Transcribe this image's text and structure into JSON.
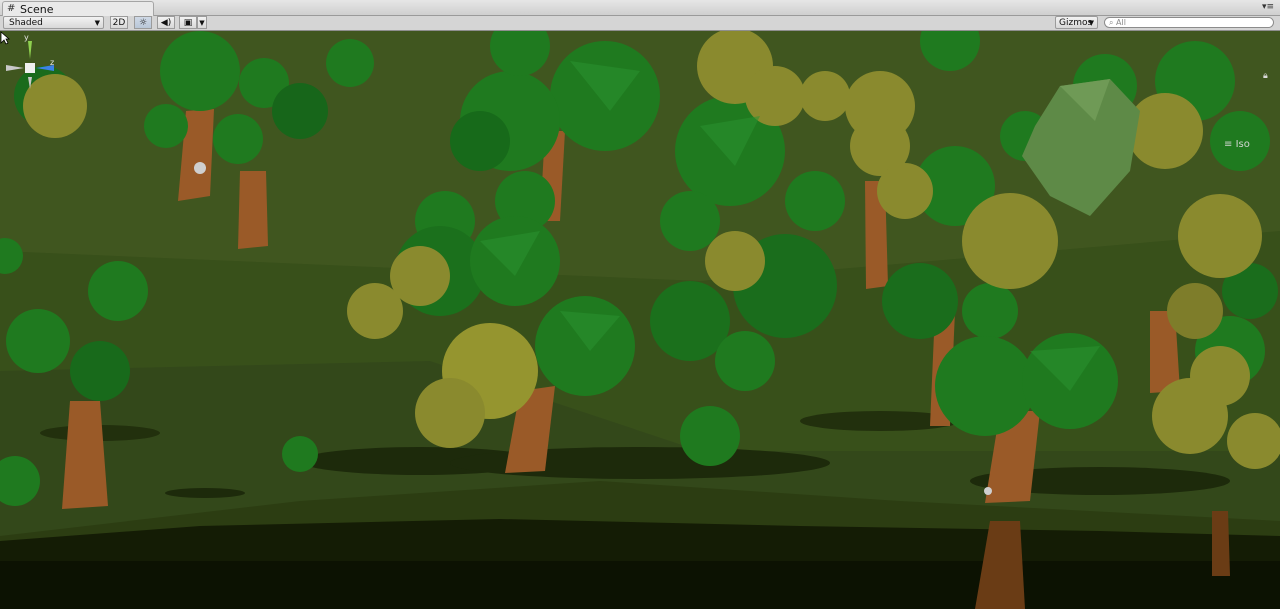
{
  "window": {
    "tab_title": "Scene",
    "tab_icon": "grid-icon",
    "menu_icon": "window-menu-icon"
  },
  "toolbar": {
    "shading_mode": "Shaded",
    "toggle_2d": "2D",
    "lighting_icon": "sun-icon",
    "audio_icon": "speaker-icon",
    "effects_icon": "image-icon",
    "gizmos_label": "Gizmos",
    "search_placeholder": "All"
  },
  "scene_gizmo": {
    "y_label": "y",
    "z_label": "z",
    "projection_label": "Iso",
    "colors": {
      "y_axis": "#8fd14f",
      "z_axis": "#3c82e6",
      "x_axis": "#d9534f"
    }
  },
  "scene": {
    "palette": {
      "sky_ground_far": "#3d5220",
      "ground": "#33461a",
      "ground_dark": "#1c2607",
      "foliage_green": "#1f7a1f",
      "foliage_olive": "#8a8a2e",
      "trunk": "#9a5a28"
    }
  }
}
